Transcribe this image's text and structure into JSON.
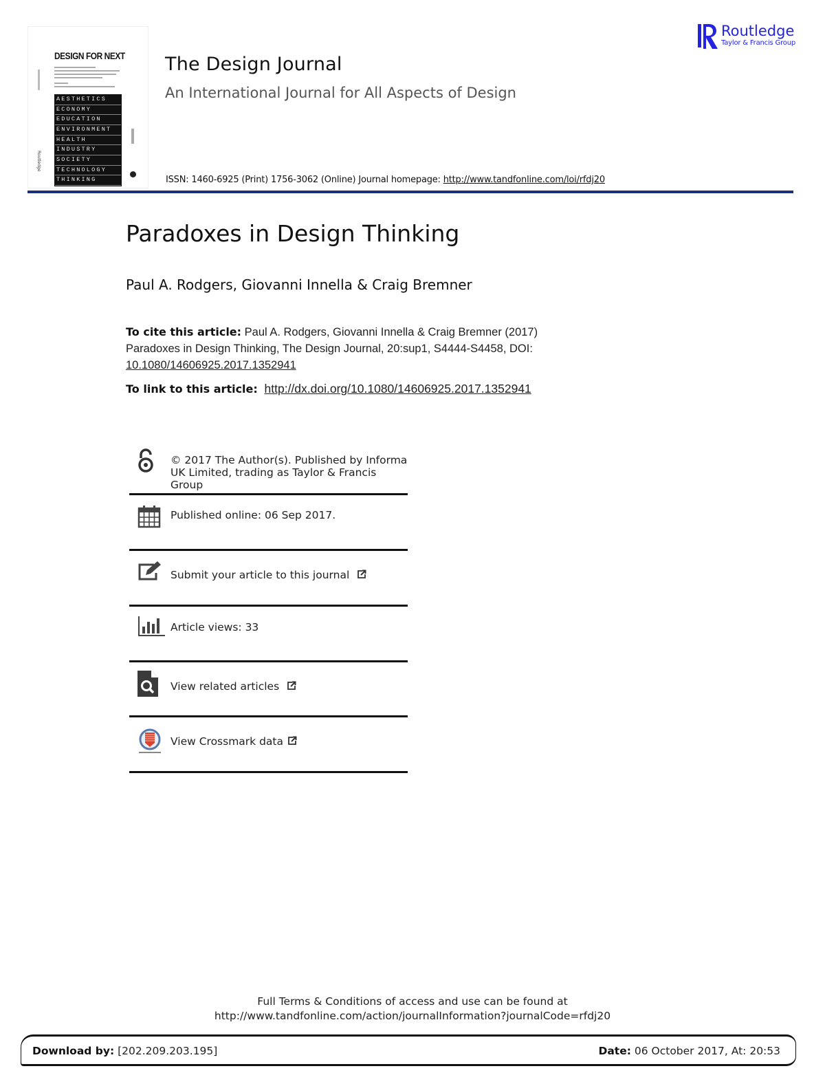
{
  "header": {
    "cover": {
      "title": "DESIGN FOR NEXT",
      "grid_words": [
        "AESTHETICS",
        "ECONOMY",
        "EDUCATION",
        "ENVIRONMENT",
        "HEALTH",
        "INDUSTRY",
        "SOCIETY",
        "TECHNOLOGY",
        "THINKING"
      ],
      "publisher": "Routledge"
    },
    "journal_title": "The Design Journal",
    "journal_subtitle": "An International Journal for All Aspects of Design",
    "issn_text": "ISSN: 1460-6925 (Print) 1756-3062 (Online) Journal homepage: ",
    "homepage_url": "http://www.tandfonline.com/loi/rfdj20",
    "publisher_logo": {
      "name": "Routledge",
      "group": "Taylor & Francis Group",
      "color": "#2424e0"
    },
    "rule_color": "#1b2f7a"
  },
  "article": {
    "title": "Paradoxes in Design Thinking",
    "authors": "Paul A. Rodgers, Giovanni Innella & Craig Bremner",
    "cite_label": "To cite this article:",
    "cite_line1": " Paul A. Rodgers, Giovanni Innella & Craig Bremner (2017)",
    "cite_line2": "Paradoxes in Design Thinking, The Design Journal, 20:sup1, S4444-S4458, DOI:",
    "cite_doi": "10.1080/14606925.2017.1352941",
    "link_label": "To link to this article:",
    "link_url": "http://dx.doi.org/10.1080/14606925.2017.1352941"
  },
  "info_items": [
    {
      "icon": "open-access-icon",
      "line1": "© 2017 The Author(s). Published by Informa",
      "line2": "UK Limited, trading as Taylor & Francis",
      "line3": "Group"
    },
    {
      "icon": "calendar-icon",
      "label": "Published online: 06 Sep 2017."
    },
    {
      "icon": "edit-icon",
      "label": "Submit your article to this journal"
    },
    {
      "icon": "bar-chart-icon",
      "label": "Article views: 33"
    },
    {
      "icon": "search-document-icon",
      "label": "View related articles"
    },
    {
      "icon": "crossmark-icon",
      "label": "View Crossmark data"
    }
  ],
  "footer": {
    "terms_line1": "Full Terms & Conditions of access and use can be found at",
    "terms_line2": "http://www.tandfonline.com/action/journalInformation?journalCode=rfdj20",
    "download_label": "Download by:",
    "download_value": " [202.209.203.195]",
    "date_label": "Date:",
    "date_value": " 06 October 2017, At: 20:53"
  }
}
